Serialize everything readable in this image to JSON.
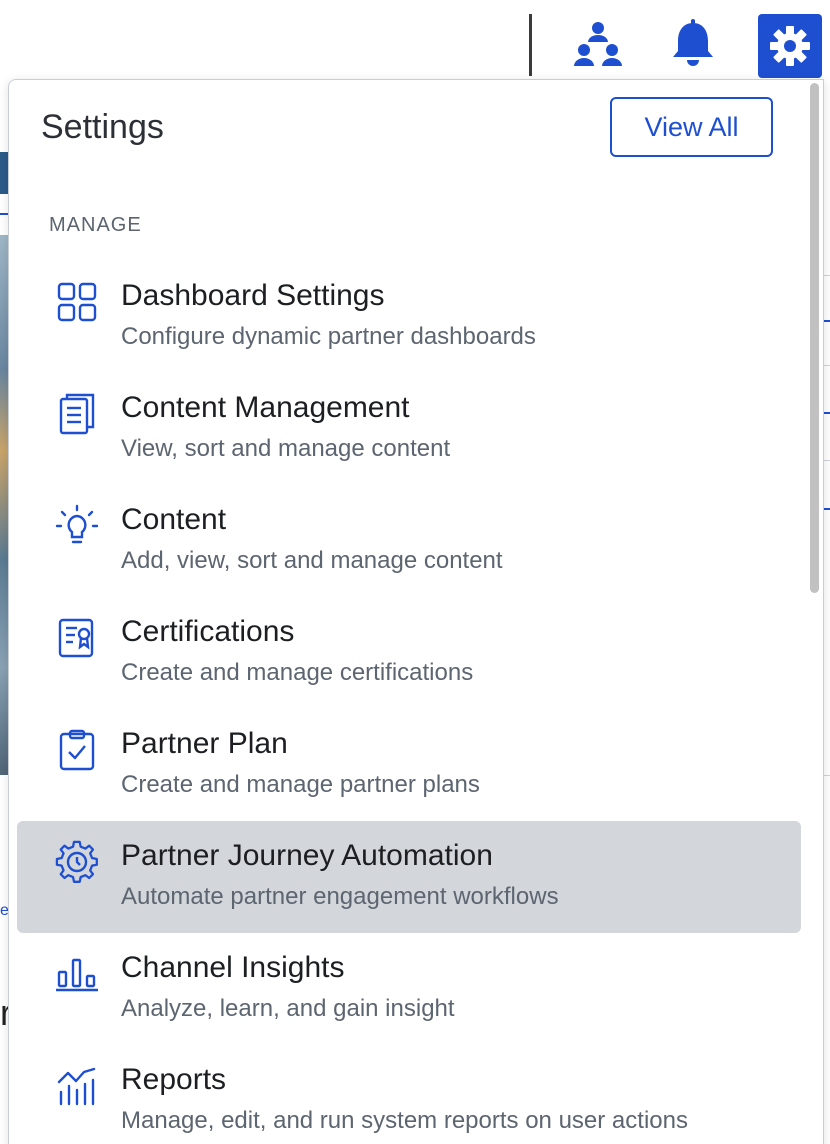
{
  "topbar": {
    "icons": [
      "org-chart-icon",
      "bell-icon",
      "gear-icon"
    ],
    "accent_color": "#1f4fd1"
  },
  "panel": {
    "title": "Settings",
    "view_all_label": "View All",
    "section_label": "MANAGE",
    "items": [
      {
        "icon": "grid-icon",
        "title": "Dashboard Settings",
        "description": "Configure dynamic partner dashboards",
        "active": false
      },
      {
        "icon": "document-icon",
        "title": "Content Management",
        "description": "View, sort and manage content",
        "active": false
      },
      {
        "icon": "lightbulb-icon",
        "title": "Content",
        "description": "Add, view, sort and manage content",
        "active": false
      },
      {
        "icon": "certificate-icon",
        "title": "Certifications",
        "description": "Create and manage certifications",
        "active": false
      },
      {
        "icon": "clipboard-check-icon",
        "title": "Partner Plan",
        "description": "Create and manage partner plans",
        "active": false
      },
      {
        "icon": "gear-clock-icon",
        "title": "Partner Journey Automation",
        "description": "Automate partner engagement workflows",
        "active": true
      },
      {
        "icon": "bar-chart-icon",
        "title": "Channel Insights",
        "description": "Analyze, learn, and gain insight",
        "active": false
      },
      {
        "icon": "line-chart-icon",
        "title": "Reports",
        "description": "Manage, edit, and run system reports on user actions",
        "active": false
      }
    ]
  },
  "background": {
    "partial_letter_e": "e",
    "partial_letter_r": "r"
  }
}
